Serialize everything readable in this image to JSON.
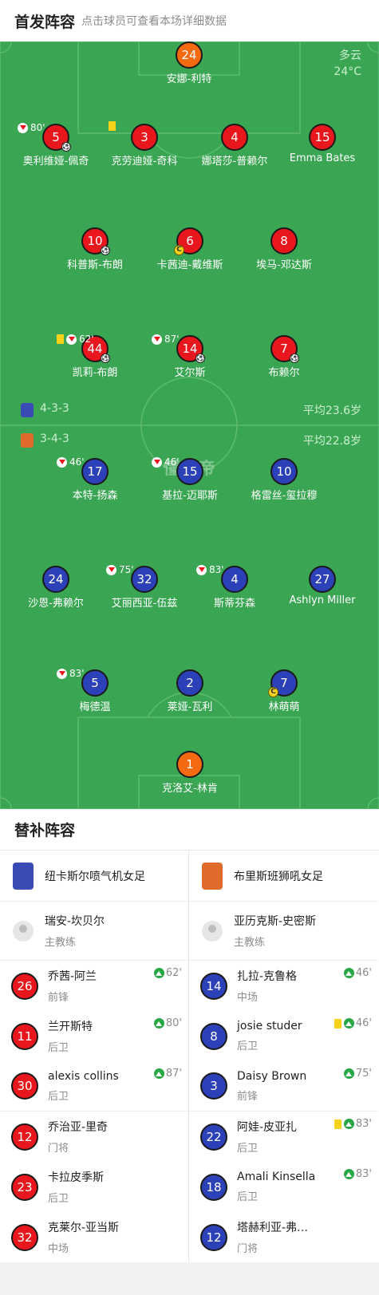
{
  "header": {
    "title": "首发阵容",
    "hint": "点击球员可查看本场详细数据"
  },
  "weather": {
    "condition": "多云",
    "temperature": "24°C"
  },
  "watermark": "懂球帝",
  "home": {
    "formation": "4-3-3",
    "avg_age": "平均23.6岁",
    "color": "#e8161d"
  },
  "away": {
    "formation": "3-4-3",
    "avg_age": "平均22.8岁",
    "color": "#2c40b8"
  },
  "pitch": {
    "home_gk": {
      "number": "24",
      "name": "安娜-利特"
    },
    "home_def": [
      {
        "number": "5",
        "name": "奥利维娅-佩奇",
        "sub_out": "80'"
      },
      {
        "number": "3",
        "name": "克劳迪娅-奇科"
      },
      {
        "number": "4",
        "name": "娜塔莎-普赖尔"
      },
      {
        "number": "15",
        "name": "Emma Bates"
      }
    ],
    "home_mid": [
      {
        "number": "10",
        "name": "科普斯-布朗"
      },
      {
        "number": "6",
        "name": "卡茜迪-戴维斯"
      },
      {
        "number": "8",
        "name": "埃马-邓达斯"
      }
    ],
    "home_fwd": [
      {
        "number": "44",
        "name": "凯莉-布朗",
        "sub_out": "62'"
      },
      {
        "number": "14",
        "name": "艾尔斯",
        "sub_out": "87'"
      },
      {
        "number": "7",
        "name": "布赖尔"
      }
    ],
    "away_fwd": [
      {
        "number": "17",
        "name": "本特-扬森",
        "sub_out": "46'"
      },
      {
        "number": "15",
        "name": "基拉-迈耶斯",
        "sub_out": "46'"
      },
      {
        "number": "10",
        "name": "格雷丝-玺拉穆"
      }
    ],
    "away_mid": [
      {
        "number": "24",
        "name": "沙恩-弗赖尔"
      },
      {
        "number": "32",
        "name": "艾丽西亚-伍兹",
        "sub_out": "75'"
      },
      {
        "number": "4",
        "name": "斯蒂芬森",
        "sub_out": "83'"
      },
      {
        "number": "27",
        "name": "Ashlyn Miller"
      }
    ],
    "away_def": [
      {
        "number": "5",
        "name": "梅德温",
        "sub_out": "83'"
      },
      {
        "number": "2",
        "name": "莱娅-瓦利"
      },
      {
        "number": "7",
        "name": "林萌萌"
      }
    ],
    "away_gk": {
      "number": "1",
      "name": "克洛艾-林肯"
    }
  },
  "subs": {
    "title": "替补阵容",
    "home": {
      "team": "纽卡斯尔喷气机女足",
      "coach": {
        "name": "瑞安-坎贝尔",
        "role": "主教练"
      },
      "players": [
        {
          "number": "26",
          "name": "乔茜-阿兰",
          "pos": "前锋",
          "sub_in": "62'"
        },
        {
          "number": "11",
          "name": "兰开斯特",
          "pos": "后卫",
          "sub_in": "80'"
        },
        {
          "number": "30",
          "name": "alexis collins",
          "pos": "后卫",
          "sub_in": "87'"
        },
        {
          "number": "12",
          "name": "乔治亚-里奇",
          "pos": "门将",
          "sub_in": ""
        },
        {
          "number": "23",
          "name": "卡拉皮季斯",
          "pos": "后卫",
          "sub_in": ""
        },
        {
          "number": "32",
          "name": "克莱尔-亚当斯",
          "pos": "中场",
          "sub_in": ""
        }
      ]
    },
    "away": {
      "team": "布里斯班狮吼女足",
      "coach": {
        "name": "亚历克斯-史密斯",
        "role": "主教练"
      },
      "players": [
        {
          "number": "14",
          "name": "扎拉-克鲁格",
          "pos": "中场",
          "sub_in": "46'"
        },
        {
          "number": "8",
          "name": "josie studer",
          "pos": "后卫",
          "sub_in": "46'"
        },
        {
          "number": "3",
          "name": "Daisy Brown",
          "pos": "前锋",
          "sub_in": "75'"
        },
        {
          "number": "22",
          "name": "阿娃-皮亚扎",
          "pos": "后卫",
          "sub_in": "83'"
        },
        {
          "number": "18",
          "name": "Amali Kinsella",
          "pos": "后卫",
          "sub_in": "83'"
        },
        {
          "number": "12",
          "name": "塔赫利亚-弗…",
          "pos": "门将",
          "sub_in": ""
        }
      ]
    }
  }
}
